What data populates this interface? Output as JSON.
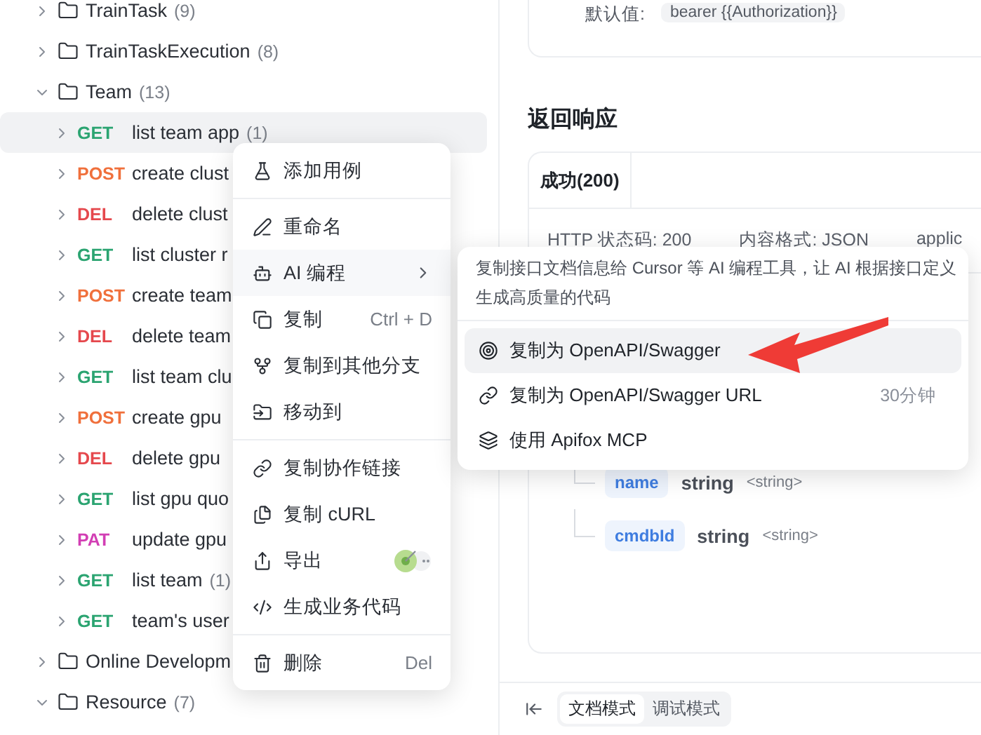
{
  "sidebar": {
    "items": [
      {
        "kind": "folder",
        "name": "TrainTask",
        "count": "(9)",
        "expanded": false
      },
      {
        "kind": "folder",
        "name": "TrainTaskExecution",
        "count": "(8)",
        "expanded": false
      },
      {
        "kind": "folder",
        "name": "Team",
        "count": "(13)",
        "expanded": true,
        "children": [
          {
            "kind": "endpoint",
            "method": "GET",
            "color": "#2ba471",
            "name": "list team app",
            "count": "(1)",
            "expanded": false,
            "selected": true
          },
          {
            "kind": "endpoint",
            "method": "POST",
            "color": "#f0703c",
            "name": "create clust",
            "expanded": false,
            "selected": false
          },
          {
            "kind": "endpoint",
            "method": "DEL",
            "color": "#e5484d",
            "name": "delete clust",
            "expanded": false,
            "selected": false
          },
          {
            "kind": "endpoint",
            "method": "GET",
            "color": "#2ba471",
            "name": "list cluster r",
            "expanded": false,
            "selected": false
          },
          {
            "kind": "endpoint",
            "method": "POST",
            "color": "#f0703c",
            "name": "create team",
            "expanded": false,
            "selected": false
          },
          {
            "kind": "endpoint",
            "method": "DEL",
            "color": "#e5484d",
            "name": "delete team",
            "expanded": false,
            "selected": false
          },
          {
            "kind": "endpoint",
            "method": "GET",
            "color": "#2ba471",
            "name": "list team clu",
            "expanded": false,
            "selected": false
          },
          {
            "kind": "endpoint",
            "method": "POST",
            "color": "#f0703c",
            "name": "create gpu",
            "expanded": false,
            "selected": false
          },
          {
            "kind": "endpoint",
            "method": "DEL",
            "color": "#e5484d",
            "name": "delete gpu",
            "expanded": false,
            "selected": false
          },
          {
            "kind": "endpoint",
            "method": "GET",
            "color": "#2ba471",
            "name": "list gpu quo",
            "expanded": false,
            "selected": false
          },
          {
            "kind": "endpoint",
            "method": "PAT",
            "color": "#d23fb4",
            "name": "update gpu",
            "expanded": false,
            "selected": false
          },
          {
            "kind": "endpoint",
            "method": "GET",
            "color": "#2ba471",
            "name": "list team",
            "count": "(1)",
            "expanded": false,
            "selected": false
          },
          {
            "kind": "endpoint",
            "method": "GET",
            "color": "#2ba471",
            "name": "team's user",
            "expanded": false,
            "selected": false
          }
        ]
      },
      {
        "kind": "folder",
        "name": "Online Developm",
        "expanded": false
      },
      {
        "kind": "folder",
        "name": "Resource",
        "count": "(7)",
        "expanded": true
      }
    ]
  },
  "main": {
    "default_label": "默认值:",
    "default_value": "bearer {{Authorization}}",
    "section_title": "返回响应",
    "tabs": [
      {
        "label": "成功(200)",
        "selected": true
      }
    ],
    "meta": [
      "HTTP 状态码: 200",
      "内容格式: JSON",
      "applic"
    ],
    "fields": [
      {
        "name": "name",
        "type": "string",
        "format": "<string>"
      },
      {
        "name": "cmdbId",
        "type": "string",
        "format": "<string>"
      }
    ]
  },
  "bottom_bar": {
    "modes": [
      {
        "label": "文档模式",
        "selected": true
      },
      {
        "label": "调试模式",
        "selected": false
      }
    ]
  },
  "context_menu": {
    "items": [
      {
        "kind": "item",
        "label": "添加用例"
      },
      {
        "kind": "divider"
      },
      {
        "kind": "item",
        "label": "重命名"
      },
      {
        "kind": "submenu",
        "label": "AI 编程",
        "expanded": true
      },
      {
        "kind": "item",
        "label": "复制",
        "shortcut": "Ctrl + D"
      },
      {
        "kind": "item",
        "label": "复制到其他分支"
      },
      {
        "kind": "item",
        "label": "移动到"
      },
      {
        "kind": "divider"
      },
      {
        "kind": "item",
        "label": "复制协作链接"
      },
      {
        "kind": "item",
        "label": "复制 cURL"
      },
      {
        "kind": "item",
        "label": "导出",
        "badge": true
      },
      {
        "kind": "item",
        "label": "生成业务代码"
      },
      {
        "kind": "divider"
      },
      {
        "kind": "item",
        "label": "删除",
        "shortcut": "Del"
      }
    ]
  },
  "submenu": {
    "description": "复制接口文档信息给 Cursor 等 AI 编程工具，让 AI 根据接口定义生成高质量的代码",
    "items": [
      {
        "label": "复制为 OpenAPI/Swagger",
        "selected": true
      },
      {
        "label": "复制为 OpenAPI/Swagger URL",
        "hint": "30分钟",
        "selected": false
      },
      {
        "label": "使用 Apifox MCP",
        "selected": false
      }
    ]
  }
}
